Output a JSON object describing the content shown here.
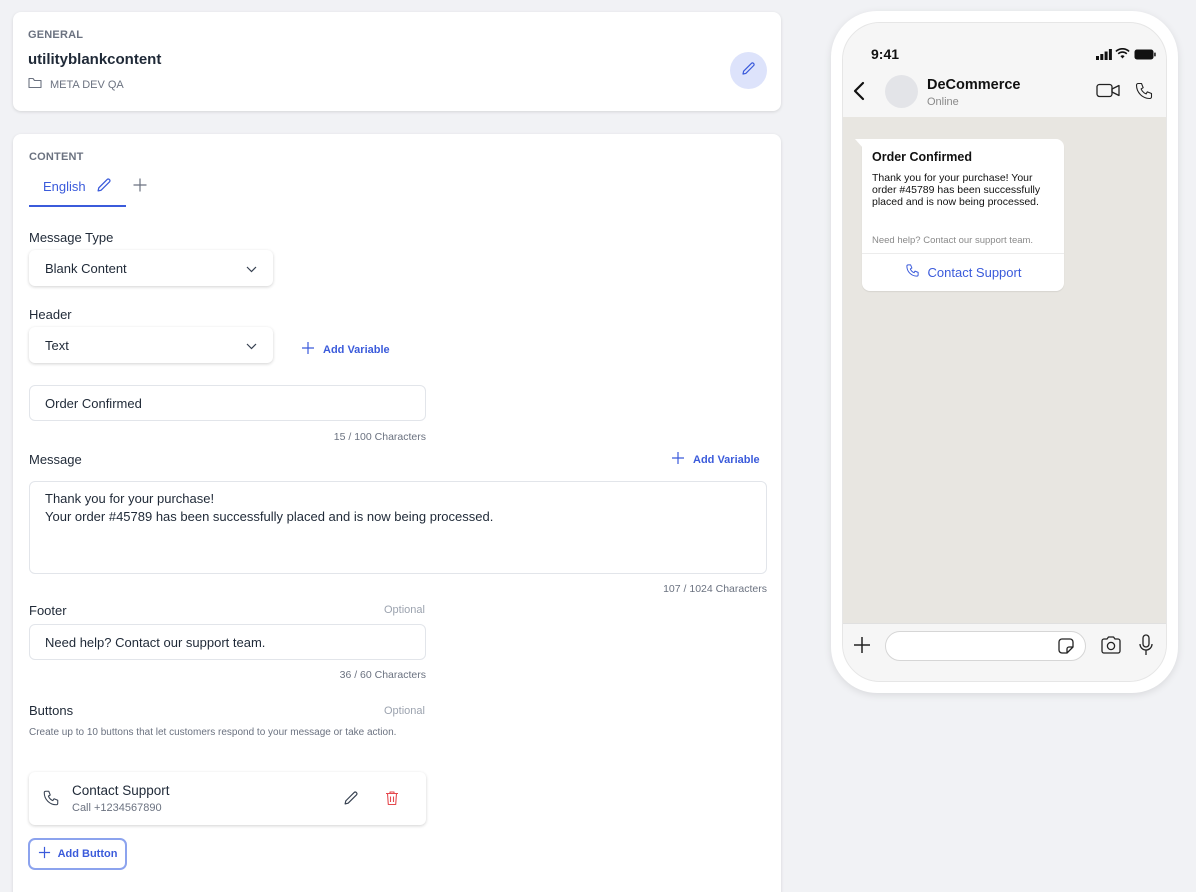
{
  "general": {
    "section": "GENERAL",
    "title": "utilityblankcontent",
    "folder": "META DEV QA"
  },
  "content": {
    "section": "CONTENT",
    "tab_label": "English",
    "message_type": {
      "label": "Message Type",
      "value": "Blank Content"
    },
    "header": {
      "label": "Header",
      "type": "Text",
      "add_variable": "Add Variable",
      "value": "Order Confirmed",
      "counter": "15 / 100 Characters"
    },
    "message": {
      "label": "Message",
      "add_variable": "Add Variable",
      "line1": "Thank you for your purchase!",
      "line2": "Your order #45789 has been successfully placed and is now being processed.",
      "counter": "107 / 1024 Characters"
    },
    "footer": {
      "label": "Footer",
      "optional": "Optional",
      "value": "Need help? Contact our support team.",
      "counter": "36 / 60 Characters"
    },
    "buttons": {
      "label": "Buttons",
      "optional": "Optional",
      "help": "Create up to 10 buttons that let customers respond to your message or take action.",
      "items": [
        {
          "title": "Contact Support",
          "subtitle": "Call +1234567890"
        }
      ],
      "add_button": "Add Button"
    }
  },
  "preview": {
    "time": "9:41",
    "contact_name": "DeCommerce",
    "contact_status": "Online",
    "bubble": {
      "title": "Order Confirmed",
      "body": "Thank you for your purchase! Your order #45789 has been successfully placed and is now being processed.",
      "footer": "Need help? Contact our support team.",
      "button": "Contact Support"
    }
  },
  "colors": {
    "accent": "#3b5bdb",
    "delete": "#e5484d",
    "page_bg": "#f1f2f5"
  }
}
